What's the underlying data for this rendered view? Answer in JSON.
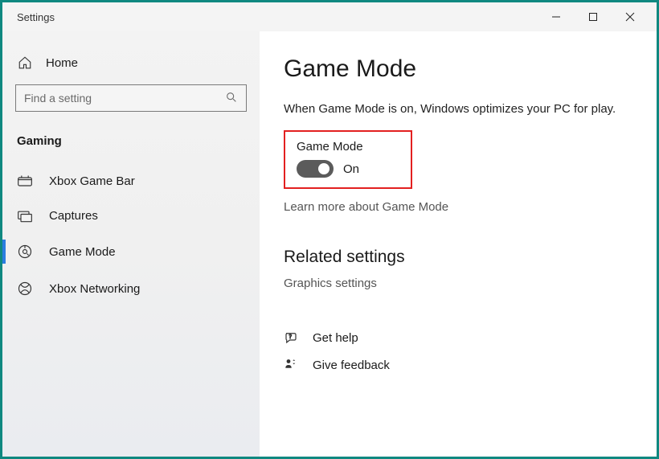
{
  "window": {
    "title": "Settings"
  },
  "sidebar": {
    "home_label": "Home",
    "search_placeholder": "Find a setting",
    "category_label": "Gaming",
    "items": [
      {
        "label": "Xbox Game Bar"
      },
      {
        "label": "Captures"
      },
      {
        "label": "Game Mode"
      },
      {
        "label": "Xbox Networking"
      }
    ]
  },
  "main": {
    "title": "Game Mode",
    "description": "When Game Mode is on, Windows optimizes your PC for play.",
    "toggle_label": "Game Mode",
    "toggle_state": "On",
    "learn_more": "Learn more about Game Mode",
    "related_heading": "Related settings",
    "graphics_link": "Graphics settings",
    "help": [
      {
        "label": "Get help"
      },
      {
        "label": "Give feedback"
      }
    ]
  }
}
